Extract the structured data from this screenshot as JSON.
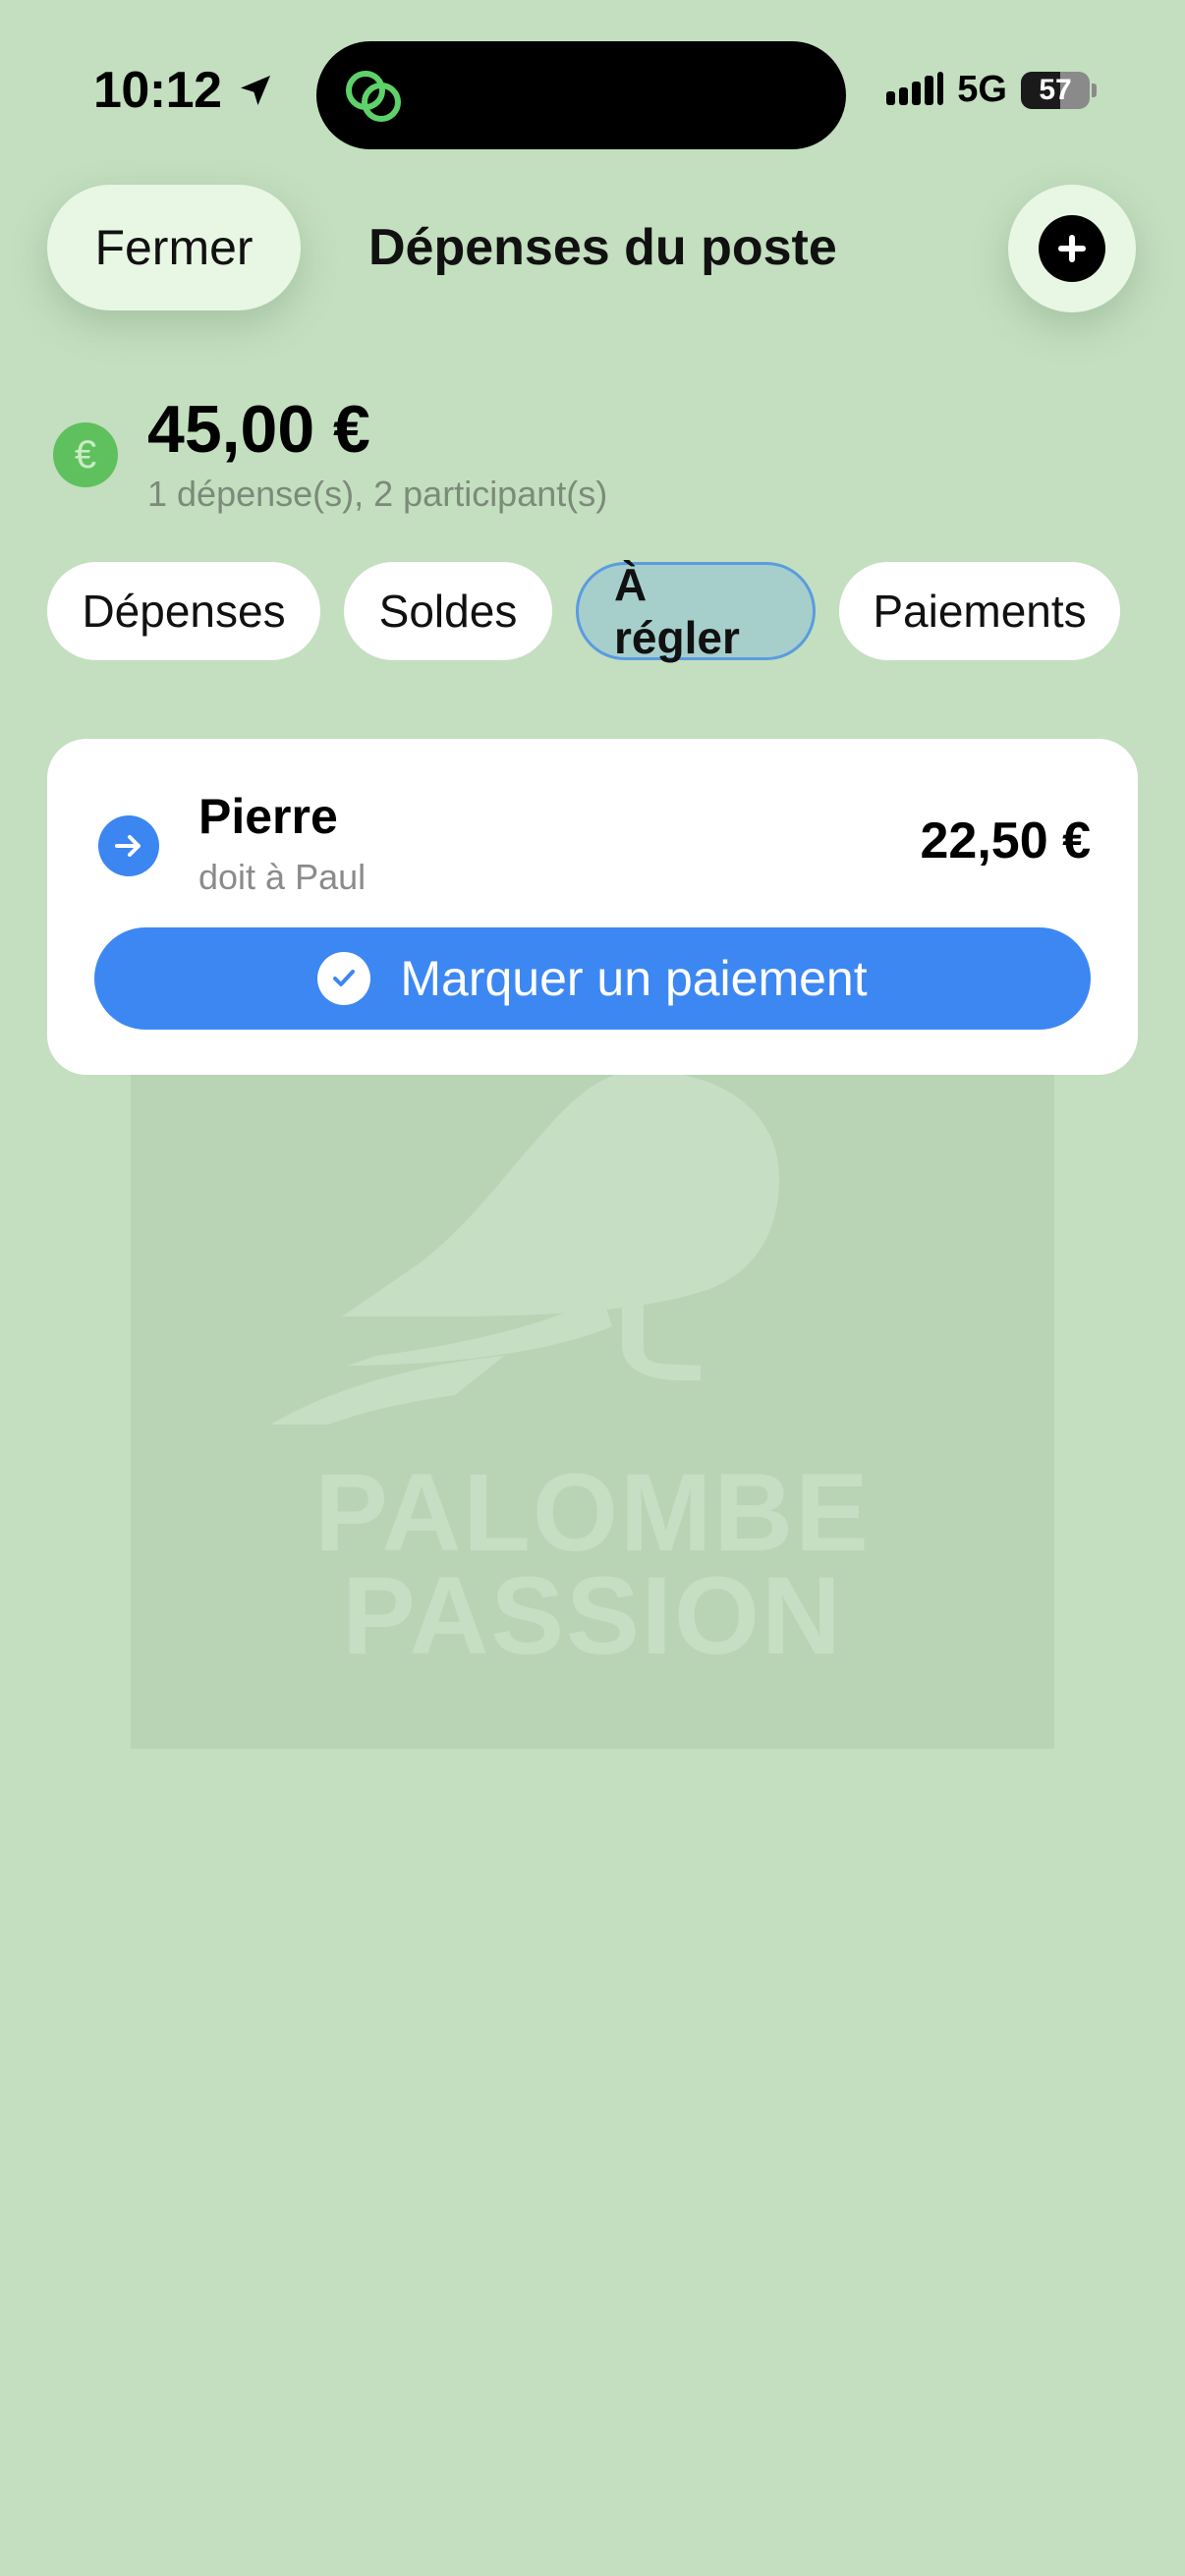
{
  "status_bar": {
    "time": "10:12",
    "network": "5G",
    "battery_level": "57",
    "icons": [
      "location-arrow-icon",
      "app-link-icon",
      "signal-icon",
      "battery-icon"
    ]
  },
  "header": {
    "close_label": "Fermer",
    "title": "Dépenses du poste",
    "add_icon": "plus-icon"
  },
  "summary": {
    "currency_symbol": "€",
    "total": "45,00 €",
    "subtitle": "1 dépense(s), 2 participant(s)"
  },
  "tabs": [
    {
      "label": "Dépenses",
      "active": false
    },
    {
      "label": "Soldes",
      "active": false
    },
    {
      "label": "À régler",
      "active": true
    },
    {
      "label": "Paiements",
      "active": false
    }
  ],
  "settlement": {
    "debtor": "Pierre",
    "detail": "doit à Paul",
    "amount": "22,50 €",
    "action_label": "Marquer un paiement"
  },
  "watermark": {
    "line1": "PALOMBE",
    "line2": "PASSION"
  },
  "colors": {
    "background": "#c3dfbf",
    "accent_blue": "#3d87f2",
    "euro_green": "#5fc05e",
    "active_tab": "#a6cfcc"
  }
}
